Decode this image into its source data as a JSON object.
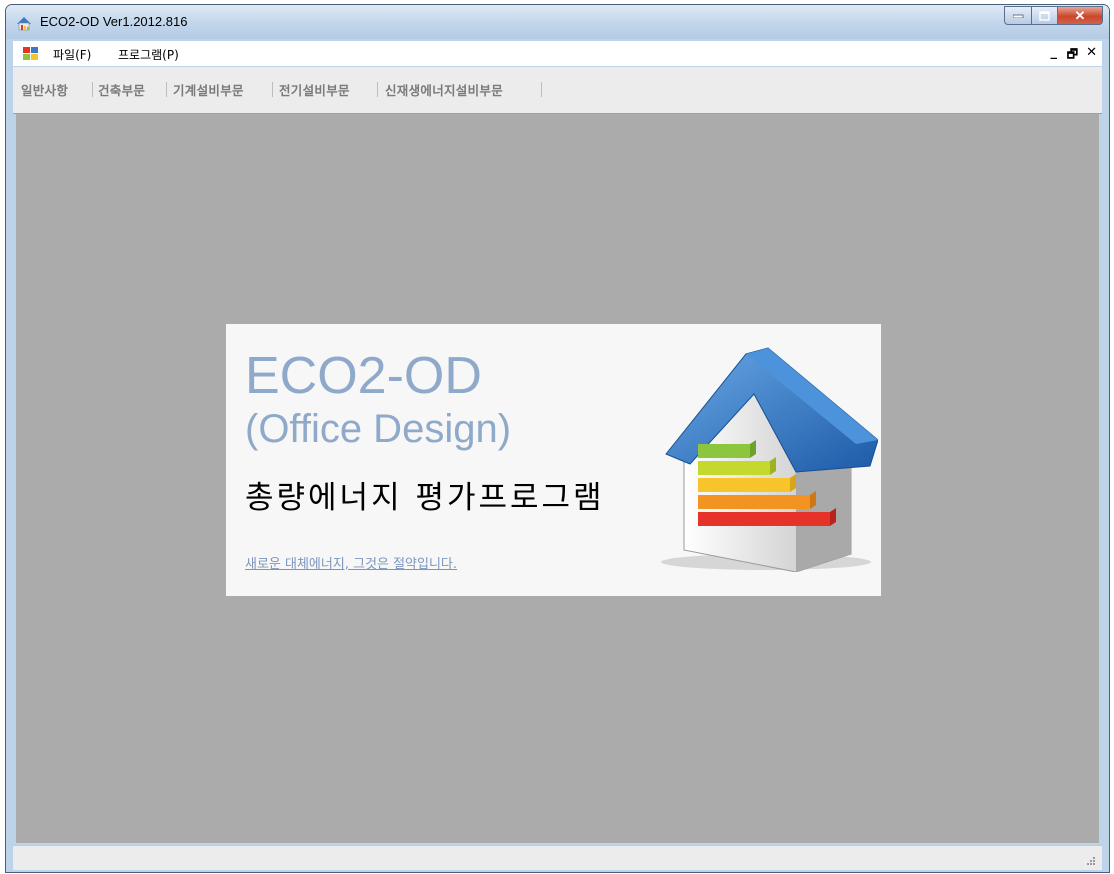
{
  "window": {
    "title": "ECO2-OD Ver1.2012.816"
  },
  "menu": {
    "file": "파일(F)",
    "program": "프로그램(P)"
  },
  "mdi_controls": {
    "minimize": "_",
    "restore": "🗗",
    "close": "✕"
  },
  "tabs": [
    "일반사항",
    "건축부문",
    "기계설비부문",
    "전기설비부문",
    "신재생에너지설비부문"
  ],
  "splash": {
    "title": "ECO2-OD",
    "subtitle": "(Office Design)",
    "korean_title": "총량에너지 평가프로그램",
    "slogan": "새로운 대체에너지, 그것은 절약입니다."
  },
  "colors": {
    "accent": "#8fa9ca",
    "client_background": "#ababab",
    "energy_bars": [
      "#8cc63f",
      "#c4d82e",
      "#f7c52b",
      "#f39321",
      "#e6332a"
    ]
  },
  "icons": [
    "app-icon",
    "menu-window-icon",
    "house-energy-icon",
    "resize-grip-icon"
  ]
}
